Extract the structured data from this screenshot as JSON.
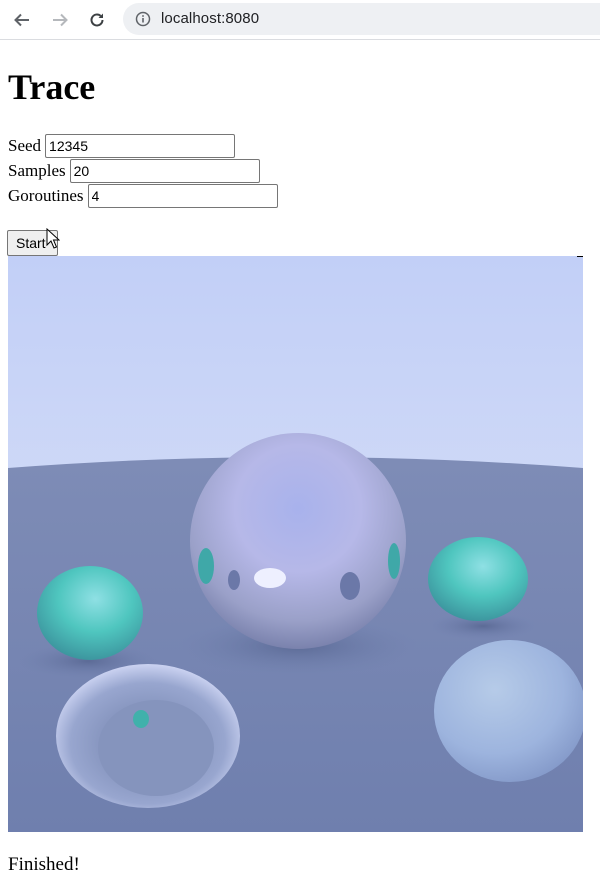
{
  "browser": {
    "url": "localhost:8080",
    "icons": [
      "back-icon",
      "forward-icon",
      "reload-icon",
      "info-icon"
    ]
  },
  "page": {
    "title": "Trace",
    "fields": {
      "seed": {
        "label": "Seed",
        "value": "12345"
      },
      "samples": {
        "label": "Samples",
        "value": "20"
      },
      "goroutines": {
        "label": "Goroutines",
        "value": "4"
      }
    },
    "start_button": "Start",
    "status": "Finished!"
  },
  "colors": {
    "sky_top": "#c4d0f8",
    "sky_bottom": "#dde5f7",
    "ground": "#7685b0",
    "teal_sphere": "#4fc9c0",
    "chrome_bar": "#eef0f3"
  }
}
